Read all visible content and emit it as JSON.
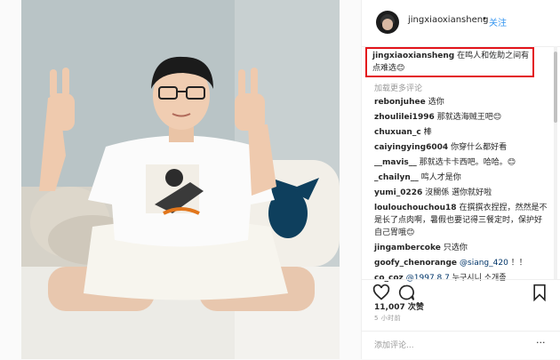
{
  "post": {
    "username": "jingxiaoxiansheng",
    "follow_label": "关注",
    "caption_user": "jingxiaoxiansheng",
    "caption_text": "在鸣人和佐助之间有点难选😊",
    "load_more": "加载更多评论",
    "likes": "11,007 次赞",
    "time": "5 小时前",
    "comment_placeholder": "添加评论...",
    "more_icon": "···"
  },
  "comments": [
    {
      "user": "rebonjuhee",
      "text": "选你"
    },
    {
      "user": "zhoulilei1996",
      "text": "那就选海贼王吧😊"
    },
    {
      "user": "chuxuan_c",
      "text": "棒"
    },
    {
      "user": "caiyingying6004",
      "text": "你穿什么都好看"
    },
    {
      "user": "__mavis__",
      "text": "那就选卡卡西吧。哈哈。😊"
    },
    {
      "user": "_chailyn__",
      "text": "鸣人才是你"
    },
    {
      "user": "yumi_0226",
      "text": "沒關係 選你就好啦"
    },
    {
      "user": "loulouchouchou18",
      "text": "在撰撰衣捏捏，然然是不是长了点肉啊，暑假也要记得三餐定时，保护好自己胃哦😊"
    },
    {
      "user": "jingambercoke",
      "text": "只选你"
    },
    {
      "user": "goofy_chenorange",
      "mention": "@siang_420",
      "text": "！！"
    },
    {
      "user": "co_coz",
      "mention": "@1997.8.7",
      "text": "누구시니 소개좀"
    }
  ],
  "icons": [
    "heart-icon",
    "comment-icon",
    "bookmark-icon",
    "more-options-icon"
  ]
}
